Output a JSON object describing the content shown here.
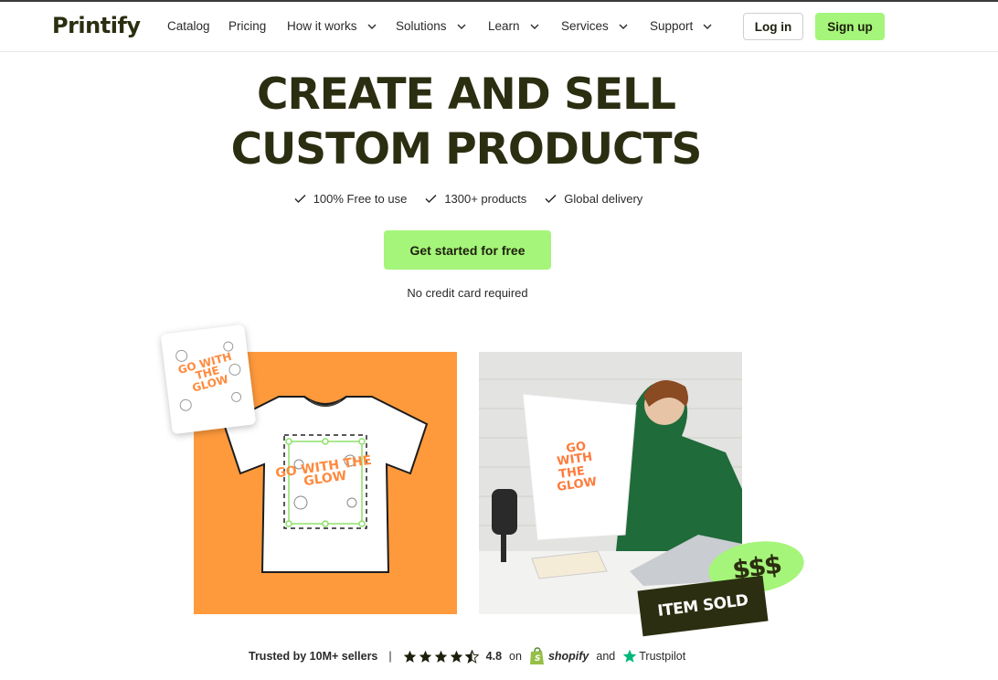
{
  "brand": {
    "logo_text": "Printify",
    "accent": "#a5f57a",
    "dark": "#2b2e10",
    "orange": "#ff9a3c"
  },
  "nav": {
    "items": [
      {
        "label": "Catalog",
        "dropdown": false
      },
      {
        "label": "Pricing",
        "dropdown": false
      },
      {
        "label": "How it works",
        "dropdown": true
      },
      {
        "label": "Solutions",
        "dropdown": true
      },
      {
        "label": "Learn",
        "dropdown": true
      },
      {
        "label": "Services",
        "dropdown": true
      },
      {
        "label": "Support",
        "dropdown": true
      }
    ],
    "login_label": "Log in",
    "signup_label": "Sign up"
  },
  "hero": {
    "title_line1": "CREATE AND SELL",
    "title_line2": "CUSTOM PRODUCTS",
    "features": [
      "100% Free to use",
      "1300+ products",
      "Global delivery"
    ],
    "cta_label": "Get started for free",
    "subtext": "No credit card required"
  },
  "visuals": {
    "design_text": "GO WITH THE GLOW",
    "badge_text": "$$$",
    "sold_text": "ITEM SOLD"
  },
  "trust": {
    "label": "Trusted by 10M+ sellers",
    "separator": "|",
    "rating": "4.8",
    "rating_stars": 4.5,
    "on_text": "on",
    "shopify_label": "shopify",
    "and_text": "and",
    "trustpilot_label": "Trustpilot"
  }
}
